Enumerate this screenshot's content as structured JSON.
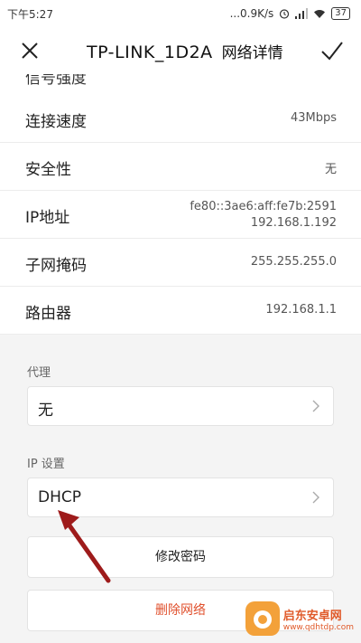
{
  "status_bar": {
    "time": "下午5:27",
    "network_speed": "...0.9K/s",
    "battery": "37"
  },
  "header": {
    "ssid": "TP-LINK_1D2A",
    "title": "网络详情",
    "close_icon": "close-icon",
    "confirm_icon": "check-icon"
  },
  "details": [
    {
      "label": "连接速度",
      "value": "43Mbps"
    },
    {
      "label": "安全性",
      "value": "无"
    },
    {
      "label": "IP地址",
      "value_line1": "fe80::3ae6:aff:fe7b:2591",
      "value_line2": "192.168.1.192"
    },
    {
      "label": "子网掩码",
      "value": "255.255.255.0"
    },
    {
      "label": "路由器",
      "value": "192.168.1.1"
    }
  ],
  "proxy": {
    "section_label": "代理",
    "value": "无"
  },
  "ip_settings": {
    "section_label": "IP 设置",
    "value": "DHCP"
  },
  "buttons": {
    "modify_password": "修改密码",
    "delete_network": "删除网络"
  },
  "watermark": {
    "name": "启东安卓网",
    "url": "www.qdhtdp.com"
  },
  "colors": {
    "danger": "#e0502d",
    "arrow": "#9e1b1b",
    "gray_bg": "#f4f4f4"
  }
}
